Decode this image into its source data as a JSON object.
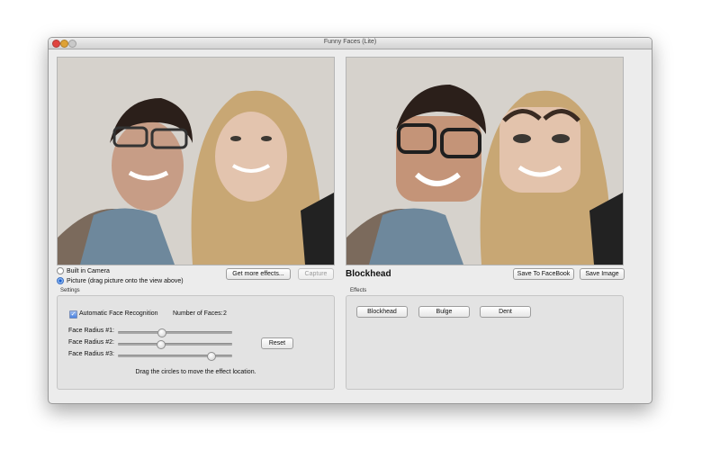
{
  "window": {
    "title": "Funny Faces (Lite)"
  },
  "source": {
    "options": [
      {
        "label": "Built in Camera",
        "selected": false
      },
      {
        "label": "Picture (drag picture onto the view above)",
        "selected": true
      }
    ],
    "get_more_label": "Get more effects...",
    "capture_label": "Capture"
  },
  "result": {
    "effect_name": "Blockhead",
    "save_facebook_label": "Save To FaceBook",
    "save_image_label": "Save Image"
  },
  "settings": {
    "title": "Settings",
    "auto_face_label": "Automatic Face Recognition",
    "auto_face_checked": true,
    "faces_label": "Number of Faces:",
    "faces_count": "2",
    "sliders": [
      {
        "label": "Face Radius #1:",
        "value": 0.38
      },
      {
        "label": "Face Radius #2:",
        "value": 0.37
      },
      {
        "label": "Face Radius #3:",
        "value": 0.81
      }
    ],
    "reset_label": "Reset",
    "hint": "Drag the circles to move the effect location."
  },
  "effects": {
    "title": "Effects",
    "items": [
      "Blockhead",
      "Bulge",
      "Dent"
    ]
  },
  "colors": {
    "accent": "#1a5fd1",
    "close": "#e0443e",
    "minimize": "#dea236"
  }
}
